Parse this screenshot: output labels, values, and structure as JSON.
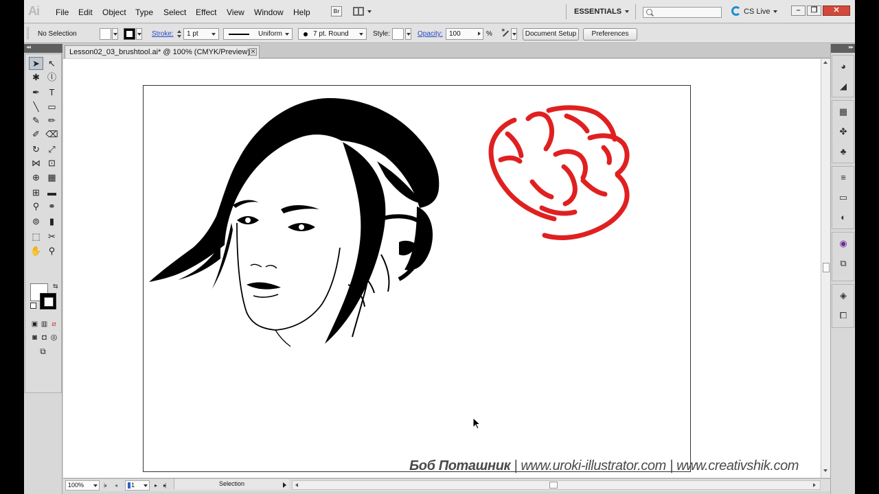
{
  "app": {
    "logo_text": "Ai",
    "menu": [
      "File",
      "Edit",
      "Object",
      "Type",
      "Select",
      "Effect",
      "View",
      "Window",
      "Help"
    ],
    "bridge_label": "Br",
    "workspace": "ESSENTIALS",
    "search_placeholder": "",
    "cslive_label": "CS Live",
    "window_buttons": {
      "minimize": "–",
      "restore": "❐",
      "close": "✕"
    }
  },
  "control_bar": {
    "selection_label": "No Selection",
    "stroke_label": "Stroke:",
    "stroke_weight": "1 pt",
    "stroke_profile": "Uniform",
    "brush_definition": "7 pt. Round",
    "style_label": "Style:",
    "opacity_label": "Opacity:",
    "opacity_value": "100",
    "opacity_unit": "%",
    "document_setup_label": "Document Setup",
    "preferences_label": "Preferences",
    "fill_color": "#ffffff",
    "stroke_color": "#000000"
  },
  "document": {
    "tab_title": "Lesson02_03_brushtool.ai* @ 100% (CMYK/Preview)",
    "tab_close": "✕"
  },
  "tools": [
    {
      "name": "selection-tool",
      "glyph": "➤"
    },
    {
      "name": "direct-selection-tool",
      "glyph": "↖"
    },
    {
      "name": "magic-wand-tool",
      "glyph": "✱"
    },
    {
      "name": "lasso-tool",
      "glyph": "ⓛ"
    },
    {
      "name": "pen-tool",
      "glyph": "✒"
    },
    {
      "name": "type-tool",
      "glyph": "T"
    },
    {
      "name": "line-segment-tool",
      "glyph": "╲"
    },
    {
      "name": "rectangle-tool",
      "glyph": "▭"
    },
    {
      "name": "paintbrush-tool",
      "glyph": "✎"
    },
    {
      "name": "pencil-tool",
      "glyph": "✏"
    },
    {
      "name": "blob-brush-tool",
      "glyph": "✐"
    },
    {
      "name": "eraser-tool",
      "glyph": "⌫"
    },
    {
      "name": "rotate-tool",
      "glyph": "↻"
    },
    {
      "name": "scale-tool",
      "glyph": "⤢"
    },
    {
      "name": "width-tool",
      "glyph": "⋈"
    },
    {
      "name": "free-transform-tool",
      "glyph": "⊡"
    },
    {
      "name": "shape-builder-tool",
      "glyph": "⊕"
    },
    {
      "name": "perspective-grid-tool",
      "glyph": "▦"
    },
    {
      "name": "mesh-tool",
      "glyph": "⊞"
    },
    {
      "name": "gradient-tool",
      "glyph": "▬"
    },
    {
      "name": "eyedropper-tool",
      "glyph": "⚲"
    },
    {
      "name": "blend-tool",
      "glyph": "⚭"
    },
    {
      "name": "symbol-sprayer-tool",
      "glyph": "⊚"
    },
    {
      "name": "column-graph-tool",
      "glyph": "▮"
    },
    {
      "name": "artboard-tool",
      "glyph": "⬚"
    },
    {
      "name": "slice-tool",
      "glyph": "✂"
    },
    {
      "name": "hand-tool",
      "glyph": "✋"
    },
    {
      "name": "zoom-tool",
      "glyph": "⚲"
    }
  ],
  "right_panels": [
    {
      "name": "color-panel-icon",
      "glyph": "◕"
    },
    {
      "name": "color-guide-panel-icon",
      "glyph": "◢"
    },
    {
      "name": "swatches-panel-icon",
      "glyph": "▦"
    },
    {
      "name": "brushes-panel-icon",
      "glyph": "✤"
    },
    {
      "name": "symbols-panel-icon",
      "glyph": "♣"
    },
    {
      "name": "stroke-panel-icon",
      "glyph": "≡"
    },
    {
      "name": "gradient-panel-icon",
      "glyph": "▭"
    },
    {
      "name": "transparency-panel-icon",
      "glyph": "◐"
    },
    {
      "name": "appearance-panel-icon",
      "glyph": "◉"
    },
    {
      "name": "graphic-styles-panel-icon",
      "glyph": "⧉"
    },
    {
      "name": "layers-panel-icon",
      "glyph": "◈"
    },
    {
      "name": "artboards-panel-icon",
      "glyph": "⧠"
    }
  ],
  "status_bar": {
    "zoom": "100%",
    "page": "1",
    "status_text": "Selection"
  },
  "watermark": {
    "author": "Боб Поташник",
    "separator": "|",
    "site1": "www.uroki-illustrator.com",
    "site2": "www.creativshik.com"
  },
  "colors": {
    "accent_red": "#e02020",
    "artwork_black": "#000000"
  }
}
